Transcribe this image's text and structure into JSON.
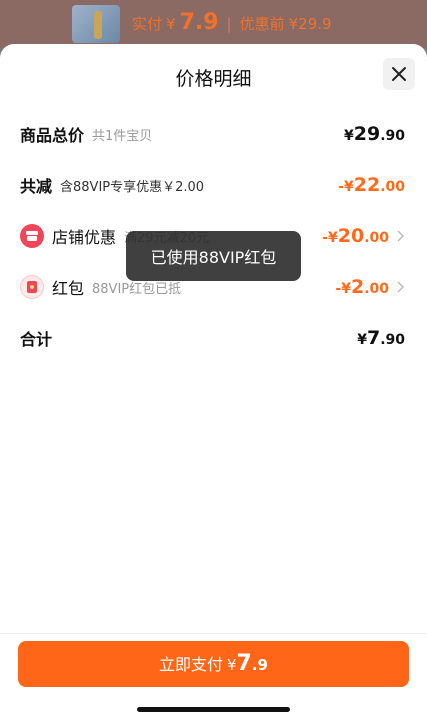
{
  "top": {
    "pay_label": "实付",
    "currency": "¥",
    "pay_amount": "7.9",
    "before_label": "优惠前",
    "before_amount": "¥29.9"
  },
  "sheet": {
    "title": "价格明细",
    "rows": [
      {
        "label": "商品总价",
        "sub": "共1件宝贝",
        "yen": "¥",
        "int": "29",
        "dec": ".90"
      },
      {
        "label": "共减",
        "sub": "含88VIP专享优惠￥2.00",
        "yen": "-¥",
        "int": "22",
        "dec": ".00"
      },
      {
        "label": "店铺优惠",
        "sub": "满29元减20元",
        "yen": "-¥",
        "int": "20",
        "dec": ".00"
      },
      {
        "label": "红包",
        "sub": "88VIP红包已抵",
        "yen": "-¥",
        "int": "2",
        "dec": ".00"
      },
      {
        "label": "合计",
        "sub": "",
        "yen": "¥",
        "int": "7",
        "dec": ".90"
      }
    ]
  },
  "toast": {
    "text": "已使用88VIP红包"
  },
  "footer": {
    "pay_button_label": "立即支付",
    "yen": "¥",
    "int": "7",
    "dec": ".9"
  },
  "icons": {
    "close": "close-icon",
    "store": "store-icon",
    "redpack": "red-packet-icon",
    "chevron": "chevron-right-icon"
  },
  "colors": {
    "accent": "#ff6617",
    "discount": "#ff6a1a",
    "store_icon": "#f1455a"
  }
}
